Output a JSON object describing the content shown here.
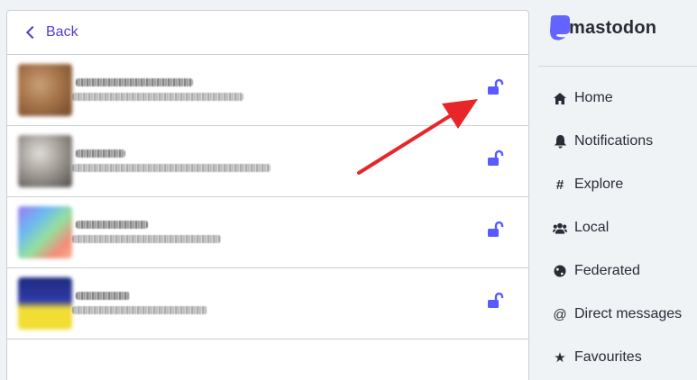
{
  "header": {
    "back_label": "Back"
  },
  "accounts": [
    {
      "avatar_colors": [
        "#a67449",
        "#7a5030",
        "#c9a079"
      ]
    },
    {
      "avatar_colors": [
        "#c9c4bc",
        "#585450",
        "#9c9690"
      ]
    },
    {
      "avatar_colors": [
        "#9b7bf0",
        "#f48c7a",
        "#94e0a0"
      ]
    },
    {
      "avatar_colors": [
        "#2f3ba8",
        "#f2dd34",
        "#1d2a7e"
      ]
    }
  ],
  "sidebar": {
    "logo": "mastodon",
    "nav": [
      {
        "label": "Home",
        "icon": "home-icon"
      },
      {
        "label": "Notifications",
        "icon": "bell-icon"
      },
      {
        "label": "Explore",
        "icon": "hashtag-icon"
      },
      {
        "label": "Local",
        "icon": "users-icon"
      },
      {
        "label": "Federated",
        "icon": "globe-icon"
      },
      {
        "label": "Direct messages",
        "icon": "at-icon"
      },
      {
        "label": "Favourites",
        "icon": "star-icon"
      }
    ]
  },
  "colors": {
    "accent": "#563acc",
    "lock": "#595aff",
    "arrow": "#e8262a"
  }
}
